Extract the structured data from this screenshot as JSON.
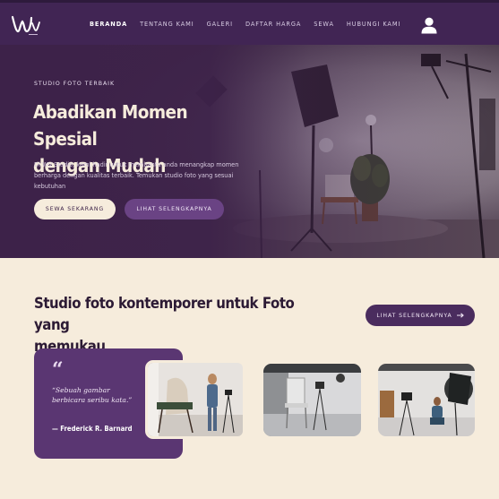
{
  "brand": {
    "logo_text": "Wv"
  },
  "nav": {
    "links": [
      "BERANDA",
      "TENTANG KAMI",
      "GALERI",
      "DAFTAR HARGA",
      "SEWA",
      "HUBUNGI KAMI"
    ],
    "active_index": 0,
    "user_icon": "user-icon"
  },
  "hero": {
    "eyebrow": "STUDIO FOTO TERBAIK",
    "title_line1": "Abadikan Momen Spesial",
    "title_line2": "dengan Mudah",
    "description": "Di WV Studio, kami hadir untuk membantu anda menangkap momen berharga dengan kualitas terbaik. Temukan studio foto yang sesuai kebutuhan",
    "primary_button": "SEWA SEKARANG",
    "secondary_button": "LIHAT SELENGKAPNYA"
  },
  "section": {
    "title_line1": "Studio foto kontemporer untuk Foto yang",
    "title_line2": "memukau",
    "more_button": "LIHAT SELENGKAPNYA",
    "more_icon": "arrow-right-icon",
    "quote_mark": "“",
    "quote": "“Sebuah gambar berbicara seribu kata.”",
    "quote_author": "— Frederick R. Barnard"
  },
  "colors": {
    "nav_bg": "#412554",
    "hero_purple": "#3b2147",
    "cream": "#f6ecdc",
    "card_purple": "#5a3672",
    "button_purple": "#6a4384",
    "dark_text": "#2c1a34"
  }
}
